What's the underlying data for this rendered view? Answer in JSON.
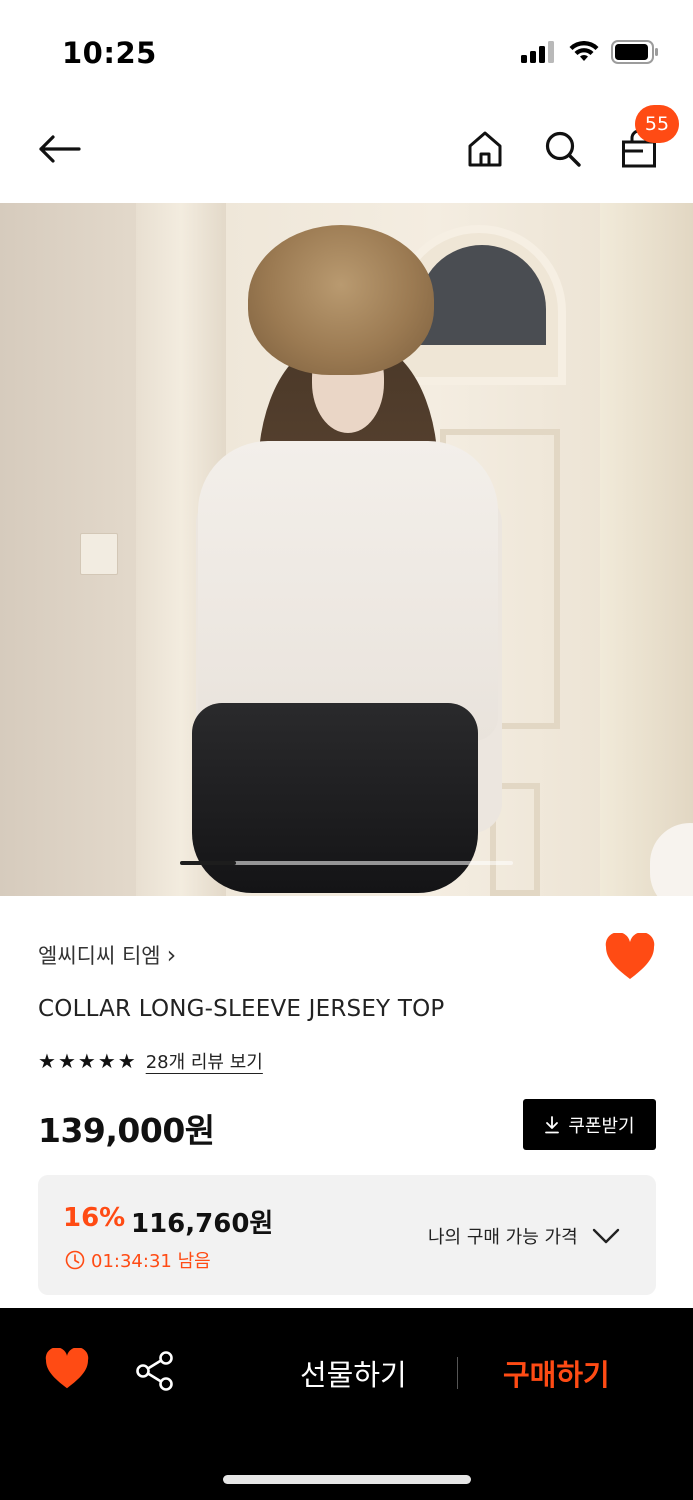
{
  "status_bar": {
    "time": "10:25"
  },
  "nav": {
    "cart_count": "55"
  },
  "gallery": {
    "current_index": 1,
    "total": 6
  },
  "product": {
    "brand": "엘씨디씨 티엠",
    "brand_chevron": "›",
    "title": "COLLAR LONG-SLEEVE JERSEY TOP",
    "rating_stars": 5,
    "review_link": "28개 리뷰 보기",
    "price": "139,000원",
    "coupon_label": "쿠폰받기",
    "wishlisted": true
  },
  "discount": {
    "percent": "16%",
    "price": "116,760원",
    "timer": "01:34:31 남음",
    "my_price_label": "나의 구매 가능 가격"
  },
  "bottom_bar": {
    "gift_label": "선물하기",
    "buy_label": "구매하기"
  },
  "colors": {
    "accent": "#ff4b14",
    "black": "#000000",
    "box_bg": "#f2f2f2"
  },
  "icons": [
    "back-arrow-icon",
    "home-icon",
    "search-icon",
    "shopping-bag-icon",
    "heart-icon",
    "star-icon",
    "download-icon",
    "clock-icon",
    "chevron-down-icon",
    "share-icon"
  ]
}
